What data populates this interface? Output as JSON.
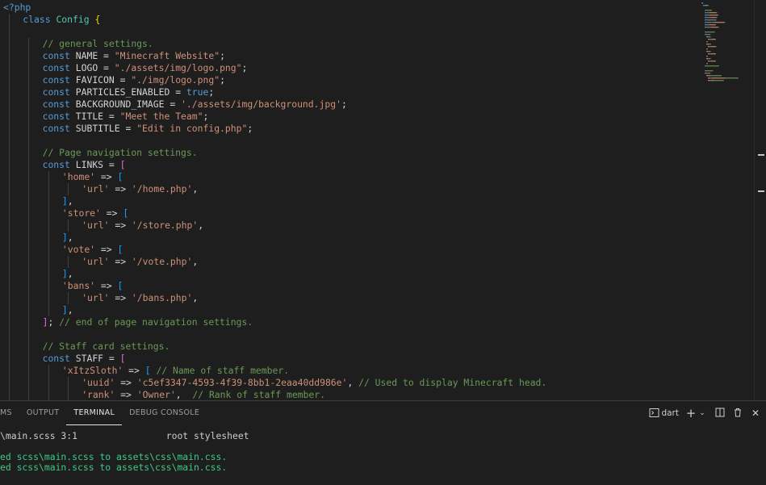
{
  "editor": {
    "lines": [
      {
        "indent": 0,
        "tokens": [
          {
            "c": "t-tag",
            "t": "<?php"
          }
        ]
      },
      {
        "indent": 1,
        "tokens": [
          {
            "c": "t-kw",
            "t": "class "
          },
          {
            "c": "t-cls",
            "t": "Config "
          },
          {
            "c": "t-b1",
            "t": "{"
          }
        ]
      },
      {
        "indent": 1,
        "tokens": []
      },
      {
        "indent": 2,
        "tokens": [
          {
            "c": "t-cmt",
            "t": "// general settings."
          }
        ]
      },
      {
        "indent": 2,
        "tokens": [
          {
            "c": "t-kw",
            "t": "const "
          },
          {
            "c": "t-const",
            "t": "NAME = "
          },
          {
            "c": "t-str",
            "t": "\"Minecraft Website\""
          },
          {
            "c": "t-op",
            "t": ";"
          }
        ]
      },
      {
        "indent": 2,
        "tokens": [
          {
            "c": "t-kw",
            "t": "const "
          },
          {
            "c": "t-const",
            "t": "LOGO = "
          },
          {
            "c": "t-str",
            "t": "\"./assets/img/logo.png\""
          },
          {
            "c": "t-op",
            "t": ";"
          }
        ]
      },
      {
        "indent": 2,
        "tokens": [
          {
            "c": "t-kw",
            "t": "const "
          },
          {
            "c": "t-const",
            "t": "FAVICON = "
          },
          {
            "c": "t-str",
            "t": "\"./img/logo.png\""
          },
          {
            "c": "t-op",
            "t": ";"
          }
        ]
      },
      {
        "indent": 2,
        "tokens": [
          {
            "c": "t-kw",
            "t": "const "
          },
          {
            "c": "t-const",
            "t": "PARTICLES_ENABLED = "
          },
          {
            "c": "t-bool",
            "t": "true"
          },
          {
            "c": "t-op",
            "t": ";"
          }
        ]
      },
      {
        "indent": 2,
        "tokens": [
          {
            "c": "t-kw",
            "t": "const "
          },
          {
            "c": "t-const",
            "t": "BACKGROUND_IMAGE = "
          },
          {
            "c": "t-str",
            "t": "'./assets/img/background.jpg'"
          },
          {
            "c": "t-op",
            "t": ";"
          }
        ]
      },
      {
        "indent": 2,
        "tokens": [
          {
            "c": "t-kw",
            "t": "const "
          },
          {
            "c": "t-const",
            "t": "TITLE = "
          },
          {
            "c": "t-str",
            "t": "\"Meet the Team\""
          },
          {
            "c": "t-op",
            "t": ";"
          }
        ]
      },
      {
        "indent": 2,
        "tokens": [
          {
            "c": "t-kw",
            "t": "const "
          },
          {
            "c": "t-const",
            "t": "SUBTITLE = "
          },
          {
            "c": "t-str",
            "t": "\"Edit in config.php\""
          },
          {
            "c": "t-op",
            "t": ";"
          }
        ]
      },
      {
        "indent": 2,
        "tokens": []
      },
      {
        "indent": 2,
        "tokens": [
          {
            "c": "t-cmt",
            "t": "// Page navigation settings."
          }
        ]
      },
      {
        "indent": 2,
        "tokens": [
          {
            "c": "t-kw",
            "t": "const "
          },
          {
            "c": "t-const",
            "t": "LINKS = "
          },
          {
            "c": "t-b2",
            "t": "["
          }
        ]
      },
      {
        "indent": 3,
        "tokens": [
          {
            "c": "t-str",
            "t": "'home'"
          },
          {
            "c": "t-op",
            "t": " => "
          },
          {
            "c": "t-b3",
            "t": "["
          }
        ]
      },
      {
        "indent": 4,
        "tokens": [
          {
            "c": "t-str",
            "t": "'url'"
          },
          {
            "c": "t-op",
            "t": " => "
          },
          {
            "c": "t-str",
            "t": "'/home.php'"
          },
          {
            "c": "t-op",
            "t": ","
          }
        ]
      },
      {
        "indent": 3,
        "tokens": [
          {
            "c": "t-b3",
            "t": "]"
          },
          {
            "c": "t-op",
            "t": ","
          }
        ]
      },
      {
        "indent": 3,
        "tokens": [
          {
            "c": "t-str",
            "t": "'store'"
          },
          {
            "c": "t-op",
            "t": " => "
          },
          {
            "c": "t-b3",
            "t": "["
          }
        ]
      },
      {
        "indent": 4,
        "tokens": [
          {
            "c": "t-str",
            "t": "'url'"
          },
          {
            "c": "t-op",
            "t": " => "
          },
          {
            "c": "t-str",
            "t": "'/store.php'"
          },
          {
            "c": "t-op",
            "t": ","
          }
        ]
      },
      {
        "indent": 3,
        "tokens": [
          {
            "c": "t-b3",
            "t": "]"
          },
          {
            "c": "t-op",
            "t": ","
          }
        ]
      },
      {
        "indent": 3,
        "tokens": [
          {
            "c": "t-str",
            "t": "'vote'"
          },
          {
            "c": "t-op",
            "t": " => "
          },
          {
            "c": "t-b3",
            "t": "["
          }
        ]
      },
      {
        "indent": 4,
        "tokens": [
          {
            "c": "t-str",
            "t": "'url'"
          },
          {
            "c": "t-op",
            "t": " => "
          },
          {
            "c": "t-str",
            "t": "'/vote.php'"
          },
          {
            "c": "t-op",
            "t": ","
          }
        ]
      },
      {
        "indent": 3,
        "tokens": [
          {
            "c": "t-b3",
            "t": "]"
          },
          {
            "c": "t-op",
            "t": ","
          }
        ]
      },
      {
        "indent": 3,
        "tokens": [
          {
            "c": "t-str",
            "t": "'bans'"
          },
          {
            "c": "t-op",
            "t": " => "
          },
          {
            "c": "t-b3",
            "t": "["
          }
        ]
      },
      {
        "indent": 4,
        "tokens": [
          {
            "c": "t-str",
            "t": "'url'"
          },
          {
            "c": "t-op",
            "t": " => "
          },
          {
            "c": "t-str",
            "t": "'/bans.php'"
          },
          {
            "c": "t-op",
            "t": ","
          }
        ]
      },
      {
        "indent": 3,
        "tokens": [
          {
            "c": "t-b3",
            "t": "]"
          },
          {
            "c": "t-op",
            "t": ","
          }
        ]
      },
      {
        "indent": 2,
        "tokens": [
          {
            "c": "t-b2",
            "t": "]"
          },
          {
            "c": "t-op",
            "t": "; "
          },
          {
            "c": "t-cmt",
            "t": "// end of page navigation settings."
          }
        ]
      },
      {
        "indent": 2,
        "tokens": []
      },
      {
        "indent": 2,
        "tokens": [
          {
            "c": "t-cmt",
            "t": "// Staff card settings."
          }
        ]
      },
      {
        "indent": 2,
        "tokens": [
          {
            "c": "t-kw",
            "t": "const "
          },
          {
            "c": "t-const",
            "t": "STAFF = "
          },
          {
            "c": "t-b2",
            "t": "["
          }
        ]
      },
      {
        "indent": 3,
        "tokens": [
          {
            "c": "t-str",
            "t": "'xItzSloth'"
          },
          {
            "c": "t-op",
            "t": " => "
          },
          {
            "c": "t-b3",
            "t": "["
          },
          {
            "c": "t-cmt",
            "t": " // Name of staff member."
          }
        ]
      },
      {
        "indent": 4,
        "tokens": [
          {
            "c": "t-str",
            "t": "'uuid'"
          },
          {
            "c": "t-op",
            "t": " => "
          },
          {
            "c": "t-str",
            "t": "'c5ef3347-4593-4f39-8bb1-2eaa40dd986e'"
          },
          {
            "c": "t-op",
            "t": ", "
          },
          {
            "c": "t-cmt",
            "t": "// Used to display Minecraft head."
          }
        ]
      },
      {
        "indent": 4,
        "tokens": [
          {
            "c": "t-str",
            "t": "'rank'"
          },
          {
            "c": "t-op",
            "t": " => "
          },
          {
            "c": "t-str",
            "t": "'Owner'"
          },
          {
            "c": "t-op",
            "t": ",  "
          },
          {
            "c": "t-cmt",
            "t": "// Rank of staff member."
          }
        ]
      }
    ]
  },
  "panel": {
    "tabs": [
      {
        "label": "MS",
        "active": false
      },
      {
        "label": "OUTPUT",
        "active": false
      },
      {
        "label": "TERMINAL",
        "active": true
      },
      {
        "label": "DEBUG CONSOLE",
        "active": false
      }
    ],
    "shell_label": "dart",
    "terminal_lines": [
      {
        "text": "\\main.scss 3:1                root stylesheet",
        "green": false
      },
      {
        "text": "",
        "green": false
      },
      {
        "text": "ed scss\\main.scss to assets\\css\\main.css.",
        "green": true
      },
      {
        "text": "ed scss\\main.scss to assets\\css\\main.css.",
        "green": true
      }
    ]
  },
  "icons": {
    "terminal": "terminal-icon",
    "add": "plus-icon",
    "dropdown": "chevron-down-icon",
    "split": "split-icon",
    "trash": "trash-icon",
    "close": "close-icon"
  },
  "colors": {
    "keyword": "#569cd6",
    "string": "#ce9178",
    "comment": "#6a9955",
    "class": "#4ec9b0",
    "terminal_green": "#3ec98a"
  }
}
